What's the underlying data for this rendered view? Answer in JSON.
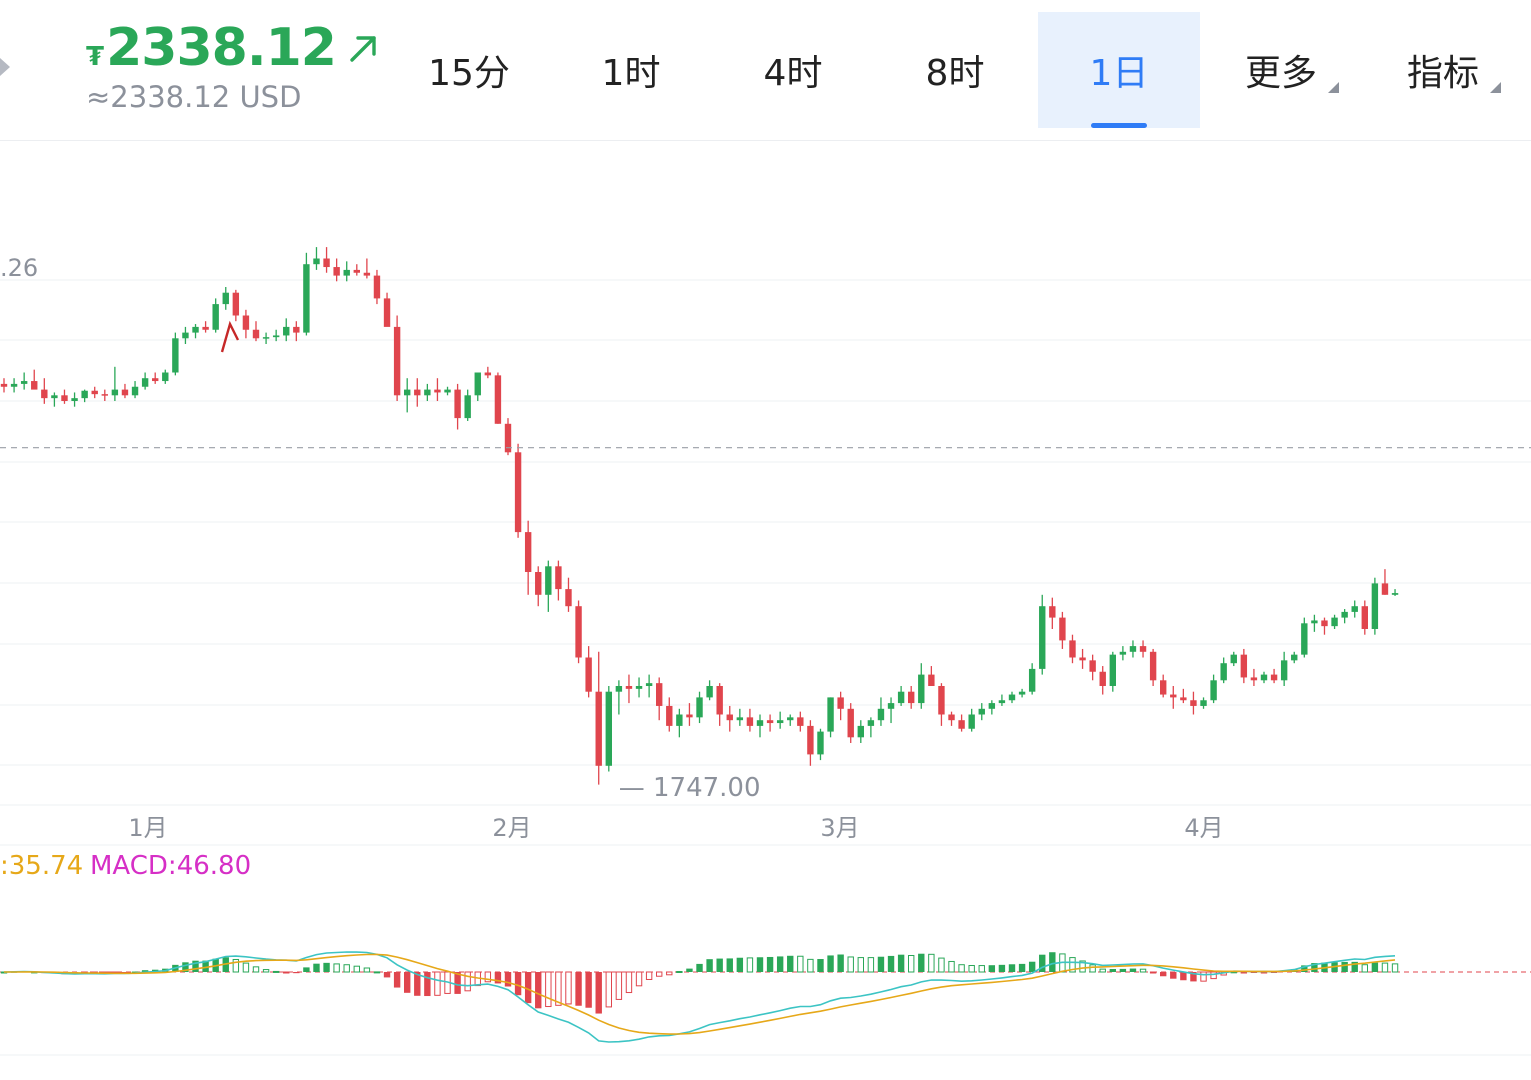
{
  "header": {
    "currency_symbol": "₮",
    "price": "2338.12",
    "price_usd": "≈2338.12 USD",
    "trend_icon": "trend-up-arrow-icon",
    "price_color": "#2aa758",
    "accent_color": "#2f7cf6"
  },
  "tabs": [
    {
      "label": "15分",
      "active": false
    },
    {
      "label": "1时",
      "active": false
    },
    {
      "label": "4时",
      "active": false
    },
    {
      "label": "8时",
      "active": false
    },
    {
      "label": "1日",
      "active": true
    },
    {
      "label": "更多",
      "active": false,
      "dropdown": true
    },
    {
      "label": "指标",
      "active": false,
      "dropdown": true
    }
  ],
  "chart_data": {
    "type": "candlestick",
    "interval": "1日",
    "up_color": "#2aa758",
    "down_color": "#e0454d",
    "price_axis": {
      "labels": [
        ".26"
      ],
      "visible_range": [
        1720,
        2720
      ]
    },
    "current_price": 2338.12,
    "min_marker": {
      "value": "1747.00",
      "label": "— 1747.00"
    },
    "x_axis": {
      "labels": [
        "1月",
        "2月",
        "3月",
        "4月"
      ]
    },
    "candles": [
      [
        2450,
        2460,
        2435,
        2445
      ],
      [
        2445,
        2460,
        2435,
        2450
      ],
      [
        2450,
        2470,
        2440,
        2455
      ],
      [
        2455,
        2475,
        2445,
        2440
      ],
      [
        2440,
        2460,
        2415,
        2425
      ],
      [
        2425,
        2435,
        2410,
        2430
      ],
      [
        2430,
        2440,
        2415,
        2420
      ],
      [
        2420,
        2435,
        2410,
        2425
      ],
      [
        2425,
        2440,
        2418,
        2438
      ],
      [
        2438,
        2445,
        2425,
        2432
      ],
      [
        2432,
        2440,
        2420,
        2430
      ],
      [
        2430,
        2480,
        2420,
        2440
      ],
      [
        2440,
        2450,
        2425,
        2430
      ],
      [
        2430,
        2455,
        2425,
        2445
      ],
      [
        2445,
        2470,
        2440,
        2460
      ],
      [
        2460,
        2470,
        2450,
        2455
      ],
      [
        2455,
        2475,
        2450,
        2470
      ],
      [
        2470,
        2540,
        2465,
        2530
      ],
      [
        2530,
        2550,
        2520,
        2540
      ],
      [
        2540,
        2555,
        2530,
        2550
      ],
      [
        2550,
        2560,
        2540,
        2545
      ],
      [
        2545,
        2600,
        2540,
        2590
      ],
      [
        2590,
        2620,
        2580,
        2610
      ],
      [
        2610,
        2615,
        2560,
        2570
      ],
      [
        2570,
        2580,
        2530,
        2545
      ],
      [
        2545,
        2560,
        2525,
        2530
      ],
      [
        2530,
        2540,
        2520,
        2532
      ],
      [
        2532,
        2545,
        2525,
        2535
      ],
      [
        2535,
        2565,
        2525,
        2550
      ],
      [
        2550,
        2560,
        2525,
        2540
      ],
      [
        2540,
        2680,
        2535,
        2660
      ],
      [
        2660,
        2690,
        2650,
        2670
      ],
      [
        2670,
        2690,
        2645,
        2655
      ],
      [
        2655,
        2670,
        2630,
        2640
      ],
      [
        2640,
        2665,
        2630,
        2650
      ],
      [
        2650,
        2660,
        2640,
        2645
      ],
      [
        2645,
        2670,
        2635,
        2640
      ],
      [
        2640,
        2650,
        2590,
        2600
      ],
      [
        2600,
        2610,
        2560,
        2550
      ],
      [
        2550,
        2570,
        2420,
        2430
      ],
      [
        2430,
        2460,
        2400,
        2440
      ],
      [
        2440,
        2460,
        2410,
        2430
      ],
      [
        2430,
        2450,
        2420,
        2440
      ],
      [
        2440,
        2460,
        2420,
        2435
      ],
      [
        2435,
        2445,
        2430,
        2440
      ],
      [
        2440,
        2450,
        2370,
        2390
      ],
      [
        2390,
        2440,
        2385,
        2430
      ],
      [
        2430,
        2460,
        2420,
        2470
      ],
      [
        2470,
        2480,
        2460,
        2465
      ],
      [
        2465,
        2470,
        2380,
        2380
      ],
      [
        2380,
        2390,
        2325,
        2330
      ],
      [
        2330,
        2345,
        2180,
        2190
      ],
      [
        2190,
        2210,
        2080,
        2120
      ],
      [
        2120,
        2130,
        2060,
        2080
      ],
      [
        2080,
        2140,
        2050,
        2130
      ],
      [
        2130,
        2140,
        2070,
        2090
      ],
      [
        2090,
        2110,
        2050,
        2060
      ],
      [
        2060,
        2070,
        1960,
        1970
      ],
      [
        1970,
        1990,
        1900,
        1910
      ],
      [
        1910,
        1980,
        1747,
        1780
      ],
      [
        1780,
        1920,
        1770,
        1910
      ],
      [
        1910,
        1930,
        1870,
        1920
      ],
      [
        1920,
        1940,
        1890,
        1915
      ],
      [
        1915,
        1935,
        1900,
        1920
      ],
      [
        1920,
        1940,
        1900,
        1925
      ],
      [
        1925,
        1935,
        1860,
        1885
      ],
      [
        1885,
        1900,
        1840,
        1850
      ],
      [
        1850,
        1880,
        1830,
        1870
      ],
      [
        1870,
        1890,
        1850,
        1865
      ],
      [
        1865,
        1910,
        1855,
        1900
      ],
      [
        1900,
        1930,
        1895,
        1920
      ],
      [
        1920,
        1925,
        1850,
        1870
      ],
      [
        1870,
        1885,
        1840,
        1860
      ],
      [
        1860,
        1880,
        1850,
        1865
      ],
      [
        1865,
        1880,
        1840,
        1850
      ],
      [
        1850,
        1870,
        1830,
        1860
      ],
      [
        1860,
        1870,
        1840,
        1855
      ],
      [
        1855,
        1875,
        1845,
        1860
      ],
      [
        1860,
        1870,
        1850,
        1865
      ],
      [
        1865,
        1875,
        1840,
        1850
      ],
      [
        1850,
        1860,
        1780,
        1800
      ],
      [
        1800,
        1845,
        1790,
        1840
      ],
      [
        1840,
        1900,
        1830,
        1900
      ],
      [
        1900,
        1910,
        1860,
        1880
      ],
      [
        1880,
        1890,
        1820,
        1830
      ],
      [
        1830,
        1860,
        1820,
        1850
      ],
      [
        1850,
        1865,
        1830,
        1860
      ],
      [
        1860,
        1900,
        1850,
        1880
      ],
      [
        1880,
        1900,
        1855,
        1890
      ],
      [
        1890,
        1920,
        1885,
        1910
      ],
      [
        1910,
        1920,
        1880,
        1890
      ],
      [
        1890,
        1960,
        1880,
        1940
      ],
      [
        1940,
        1955,
        1920,
        1920
      ],
      [
        1920,
        1925,
        1850,
        1870
      ],
      [
        1870,
        1875,
        1850,
        1860
      ],
      [
        1860,
        1870,
        1840,
        1845
      ],
      [
        1845,
        1880,
        1840,
        1870
      ],
      [
        1870,
        1890,
        1860,
        1880
      ],
      [
        1880,
        1895,
        1870,
        1890
      ],
      [
        1890,
        1905,
        1885,
        1895
      ],
      [
        1895,
        1910,
        1890,
        1905
      ],
      [
        1905,
        1915,
        1900,
        1910
      ],
      [
        1910,
        1960,
        1905,
        1950
      ],
      [
        1950,
        2080,
        1940,
        2060
      ],
      [
        2060,
        2075,
        2020,
        2040
      ],
      [
        2040,
        2050,
        1985,
        2000
      ],
      [
        2000,
        2010,
        1960,
        1970
      ],
      [
        1970,
        1985,
        1950,
        1965
      ],
      [
        1965,
        1975,
        1930,
        1945
      ],
      [
        1945,
        1955,
        1905,
        1920
      ],
      [
        1920,
        1980,
        1910,
        1975
      ],
      [
        1975,
        1990,
        1965,
        1980
      ],
      [
        1980,
        2000,
        1970,
        1990
      ],
      [
        1990,
        2000,
        1970,
        1980
      ],
      [
        1980,
        1985,
        1920,
        1930
      ],
      [
        1930,
        1940,
        1900,
        1905
      ],
      [
        1905,
        1920,
        1880,
        1900
      ],
      [
        1900,
        1915,
        1890,
        1895
      ],
      [
        1895,
        1910,
        1870,
        1885
      ],
      [
        1885,
        1900,
        1880,
        1895
      ],
      [
        1895,
        1940,
        1890,
        1930
      ],
      [
        1930,
        1970,
        1925,
        1960
      ],
      [
        1960,
        1980,
        1955,
        1975
      ],
      [
        1975,
        1985,
        1925,
        1935
      ],
      [
        1935,
        1950,
        1920,
        1930
      ],
      [
        1930,
        1945,
        1925,
        1940
      ],
      [
        1940,
        1950,
        1925,
        1930
      ],
      [
        1930,
        1980,
        1920,
        1965
      ],
      [
        1965,
        1980,
        1960,
        1975
      ],
      [
        1975,
        2040,
        1970,
        2030
      ],
      [
        2030,
        2045,
        2015,
        2035
      ],
      [
        2035,
        2040,
        2010,
        2025
      ],
      [
        2025,
        2045,
        2020,
        2040
      ],
      [
        2040,
        2055,
        2030,
        2050
      ],
      [
        2050,
        2070,
        2040,
        2060
      ],
      [
        2060,
        2070,
        2010,
        2020
      ],
      [
        2020,
        2110,
        2010,
        2100
      ],
      [
        2100,
        2125,
        2080,
        2080
      ],
      [
        2080,
        2090,
        2078,
        2083
      ]
    ]
  },
  "macd": {
    "label_prefix": ":35.74",
    "label_macd": "MACD:46.80",
    "prefix_color": "#e6a819",
    "macd_color": "#d62fc6"
  }
}
